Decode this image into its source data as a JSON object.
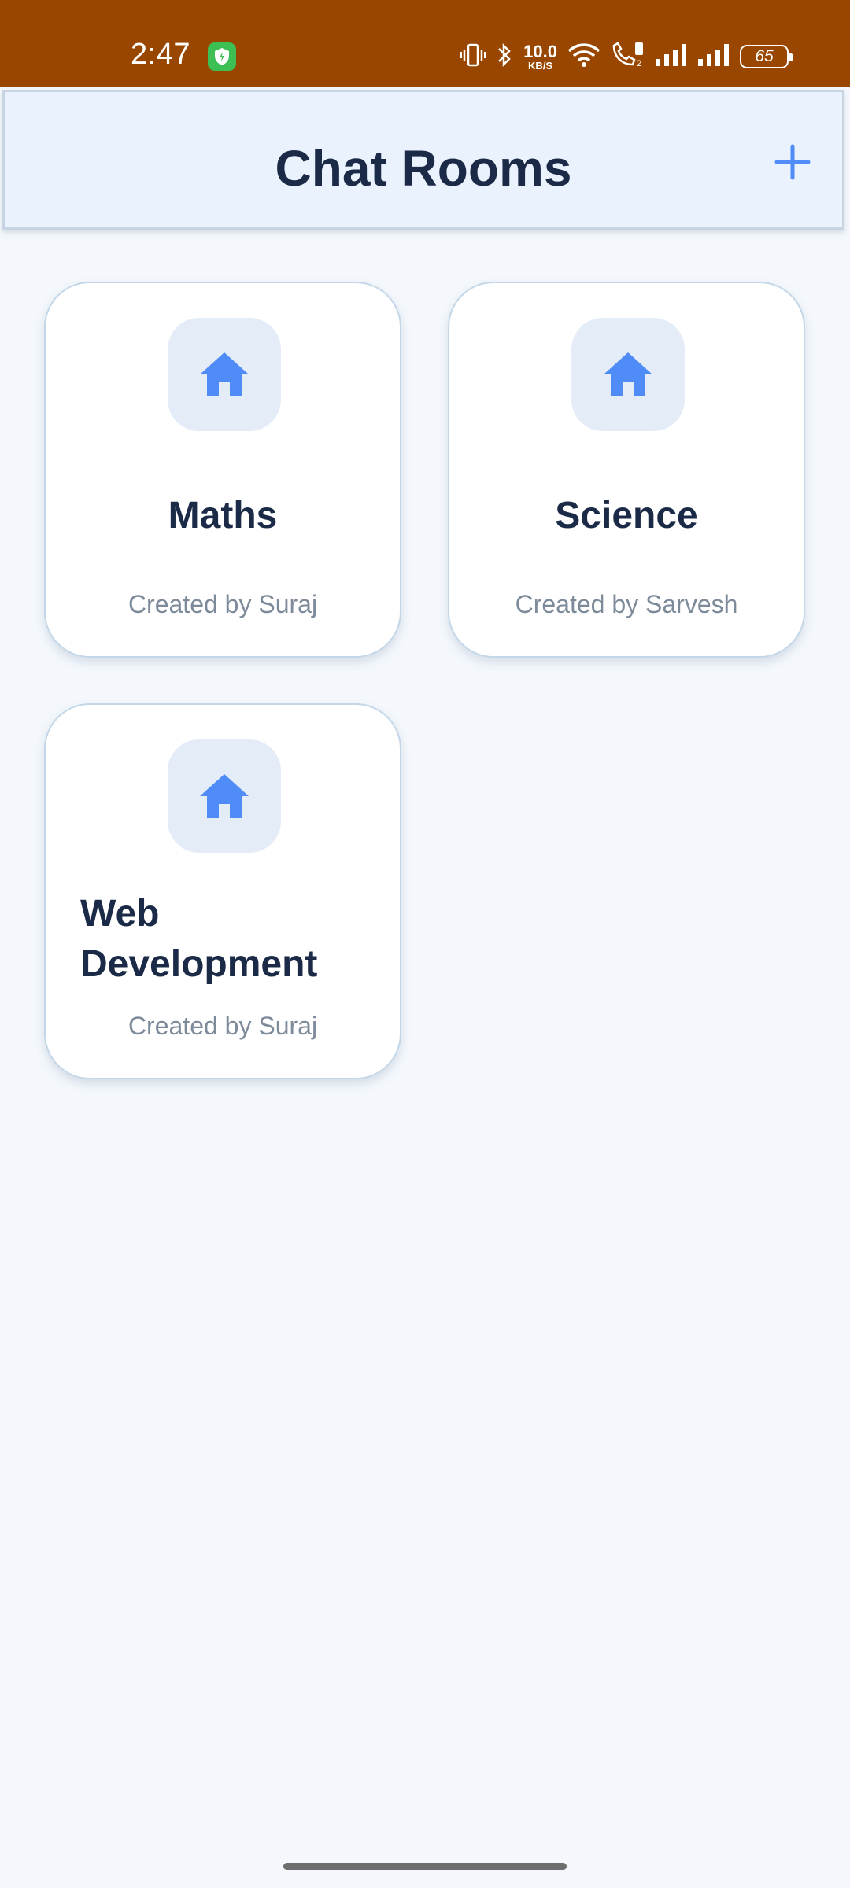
{
  "status_bar": {
    "time": "2:47",
    "net_speed_value": "10.0",
    "net_speed_unit": "KB/S",
    "battery": "65",
    "icons": [
      "shield-app-icon",
      "vibrate-icon",
      "bluetooth-icon",
      "wifi-icon",
      "volte-call-icon",
      "signal-icon",
      "signal-icon",
      "battery-icon"
    ]
  },
  "header": {
    "title": "Chat Rooms",
    "add_icon": "plus-icon"
  },
  "rooms": [
    {
      "name": "Maths",
      "creator": "Created by Suraj",
      "icon": "home-icon"
    },
    {
      "name": "Science",
      "creator": "Created by Sarvesh",
      "icon": "home-icon"
    },
    {
      "name": "Web Development",
      "creator": "Created by Suraj",
      "icon": "home-icon"
    }
  ],
  "colors": {
    "status_bar_bg": "#994700",
    "header_bg": "#eaf2fe",
    "accent": "#4f8cf7",
    "title_text": "#1b2b47",
    "subtitle_text": "#7d8a99",
    "page_bg": "#f4f8fc"
  }
}
